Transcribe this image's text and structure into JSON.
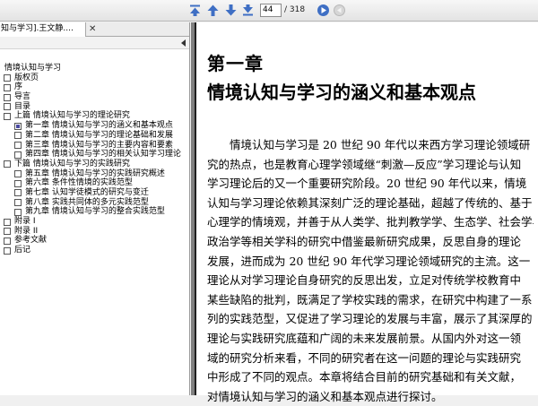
{
  "toolbar": {
    "page_current": "44",
    "page_total": "/ 318",
    "buttons": [
      "first-page",
      "previous-page",
      "next-page",
      "last-page",
      "go",
      "back"
    ]
  },
  "tab": {
    "label": "知与学习].王文静....",
    "close": "✕"
  },
  "tree": {
    "items": [
      {
        "text": "情境认知与学习",
        "level": 0,
        "box": false
      },
      {
        "text": "版权页",
        "level": 1,
        "box": true
      },
      {
        "text": "序",
        "level": 1,
        "box": true
      },
      {
        "text": "导言",
        "level": 1,
        "box": true
      },
      {
        "text": "目录",
        "level": 1,
        "box": true
      },
      {
        "text": "上篇   情境认知与学习的理论研究",
        "level": 1,
        "box": true
      },
      {
        "text": "第一章   情境认知与学习的涵义和基本观点",
        "level": 2,
        "box": true,
        "active": true
      },
      {
        "text": "第二章   情境认知与学习的理论基础和发展",
        "level": 2,
        "box": true
      },
      {
        "text": "第三章   情境认知与学习的主要内容和要素",
        "level": 2,
        "box": true
      },
      {
        "text": "第四章   情境认知与学习的相关认知学习理论",
        "level": 2,
        "box": true
      },
      {
        "text": "下篇   情境认知与学习的实践研究",
        "level": 1,
        "box": true
      },
      {
        "text": "第五章   情境认知与学习的实践研究概述",
        "level": 2,
        "box": true
      },
      {
        "text": "第六章   条件性情境的实践范型",
        "level": 2,
        "box": true
      },
      {
        "text": "第七章   认知学徒模式的研究与变迁",
        "level": 2,
        "box": true
      },
      {
        "text": "第八章   实践共同体的多元实践范型",
        "level": 2,
        "box": true
      },
      {
        "text": "第九章   情境认知与学习的整合实践范型",
        "level": 2,
        "box": true
      },
      {
        "text": "附录 I",
        "level": 1,
        "box": true
      },
      {
        "text": "附录 II",
        "level": 1,
        "box": true
      },
      {
        "text": "参考文献",
        "level": 1,
        "box": true
      },
      {
        "text": "后记",
        "level": 1,
        "box": true
      }
    ]
  },
  "document": {
    "chapter_number": "第一章",
    "chapter_title": "情境认知与学习的涵义和基本观点",
    "lines": [
      "　　情境认知与学习是 20 世纪 90 年代以来西方学习理论领域研",
      "究的热点，也是教育心理学领域继“刺激—反应”学习理论与认知",
      "学习理论后的又一个重要研究阶段。20 世纪 90 年代以来，情境",
      "认知与学习理论依赖其深刻广泛的理论基础，超越了传统的、基于",
      "心理学的情境观，并善于从人类学、批判教学学、生态学、社会学与",
      "政治学等相关学科的研究中借鉴最新研究成果，反思自身的理论",
      "发展，进而成为 20 世纪 90 年代学习理论领域研究的主流。这一",
      "理论从对学习理论自身研究的反思出发，立足对传统学校教育中",
      "某些缺陷的批判，既满足了学校实践的需求，在研究中构建了一系",
      "列的实践范型，又促进了学习理论的发展与丰富，展示了其深厚的",
      "理论与实践研究底蕴和广阔的未来发展前景。从国内外对这一领",
      "域的研究分析来看，不同的研究者在这一问题的理论与实践研究",
      "中形成了不同的观点。本章将结合目前的研究基础和有关文献，",
      "对情境认知与学习的涵义和基本观点进行探讨。"
    ]
  },
  "colors": {
    "nav_blue": "#3f6fc4",
    "toolbar_bg": "#e8e8e8",
    "doc_gutter": "#7f7f7f"
  }
}
